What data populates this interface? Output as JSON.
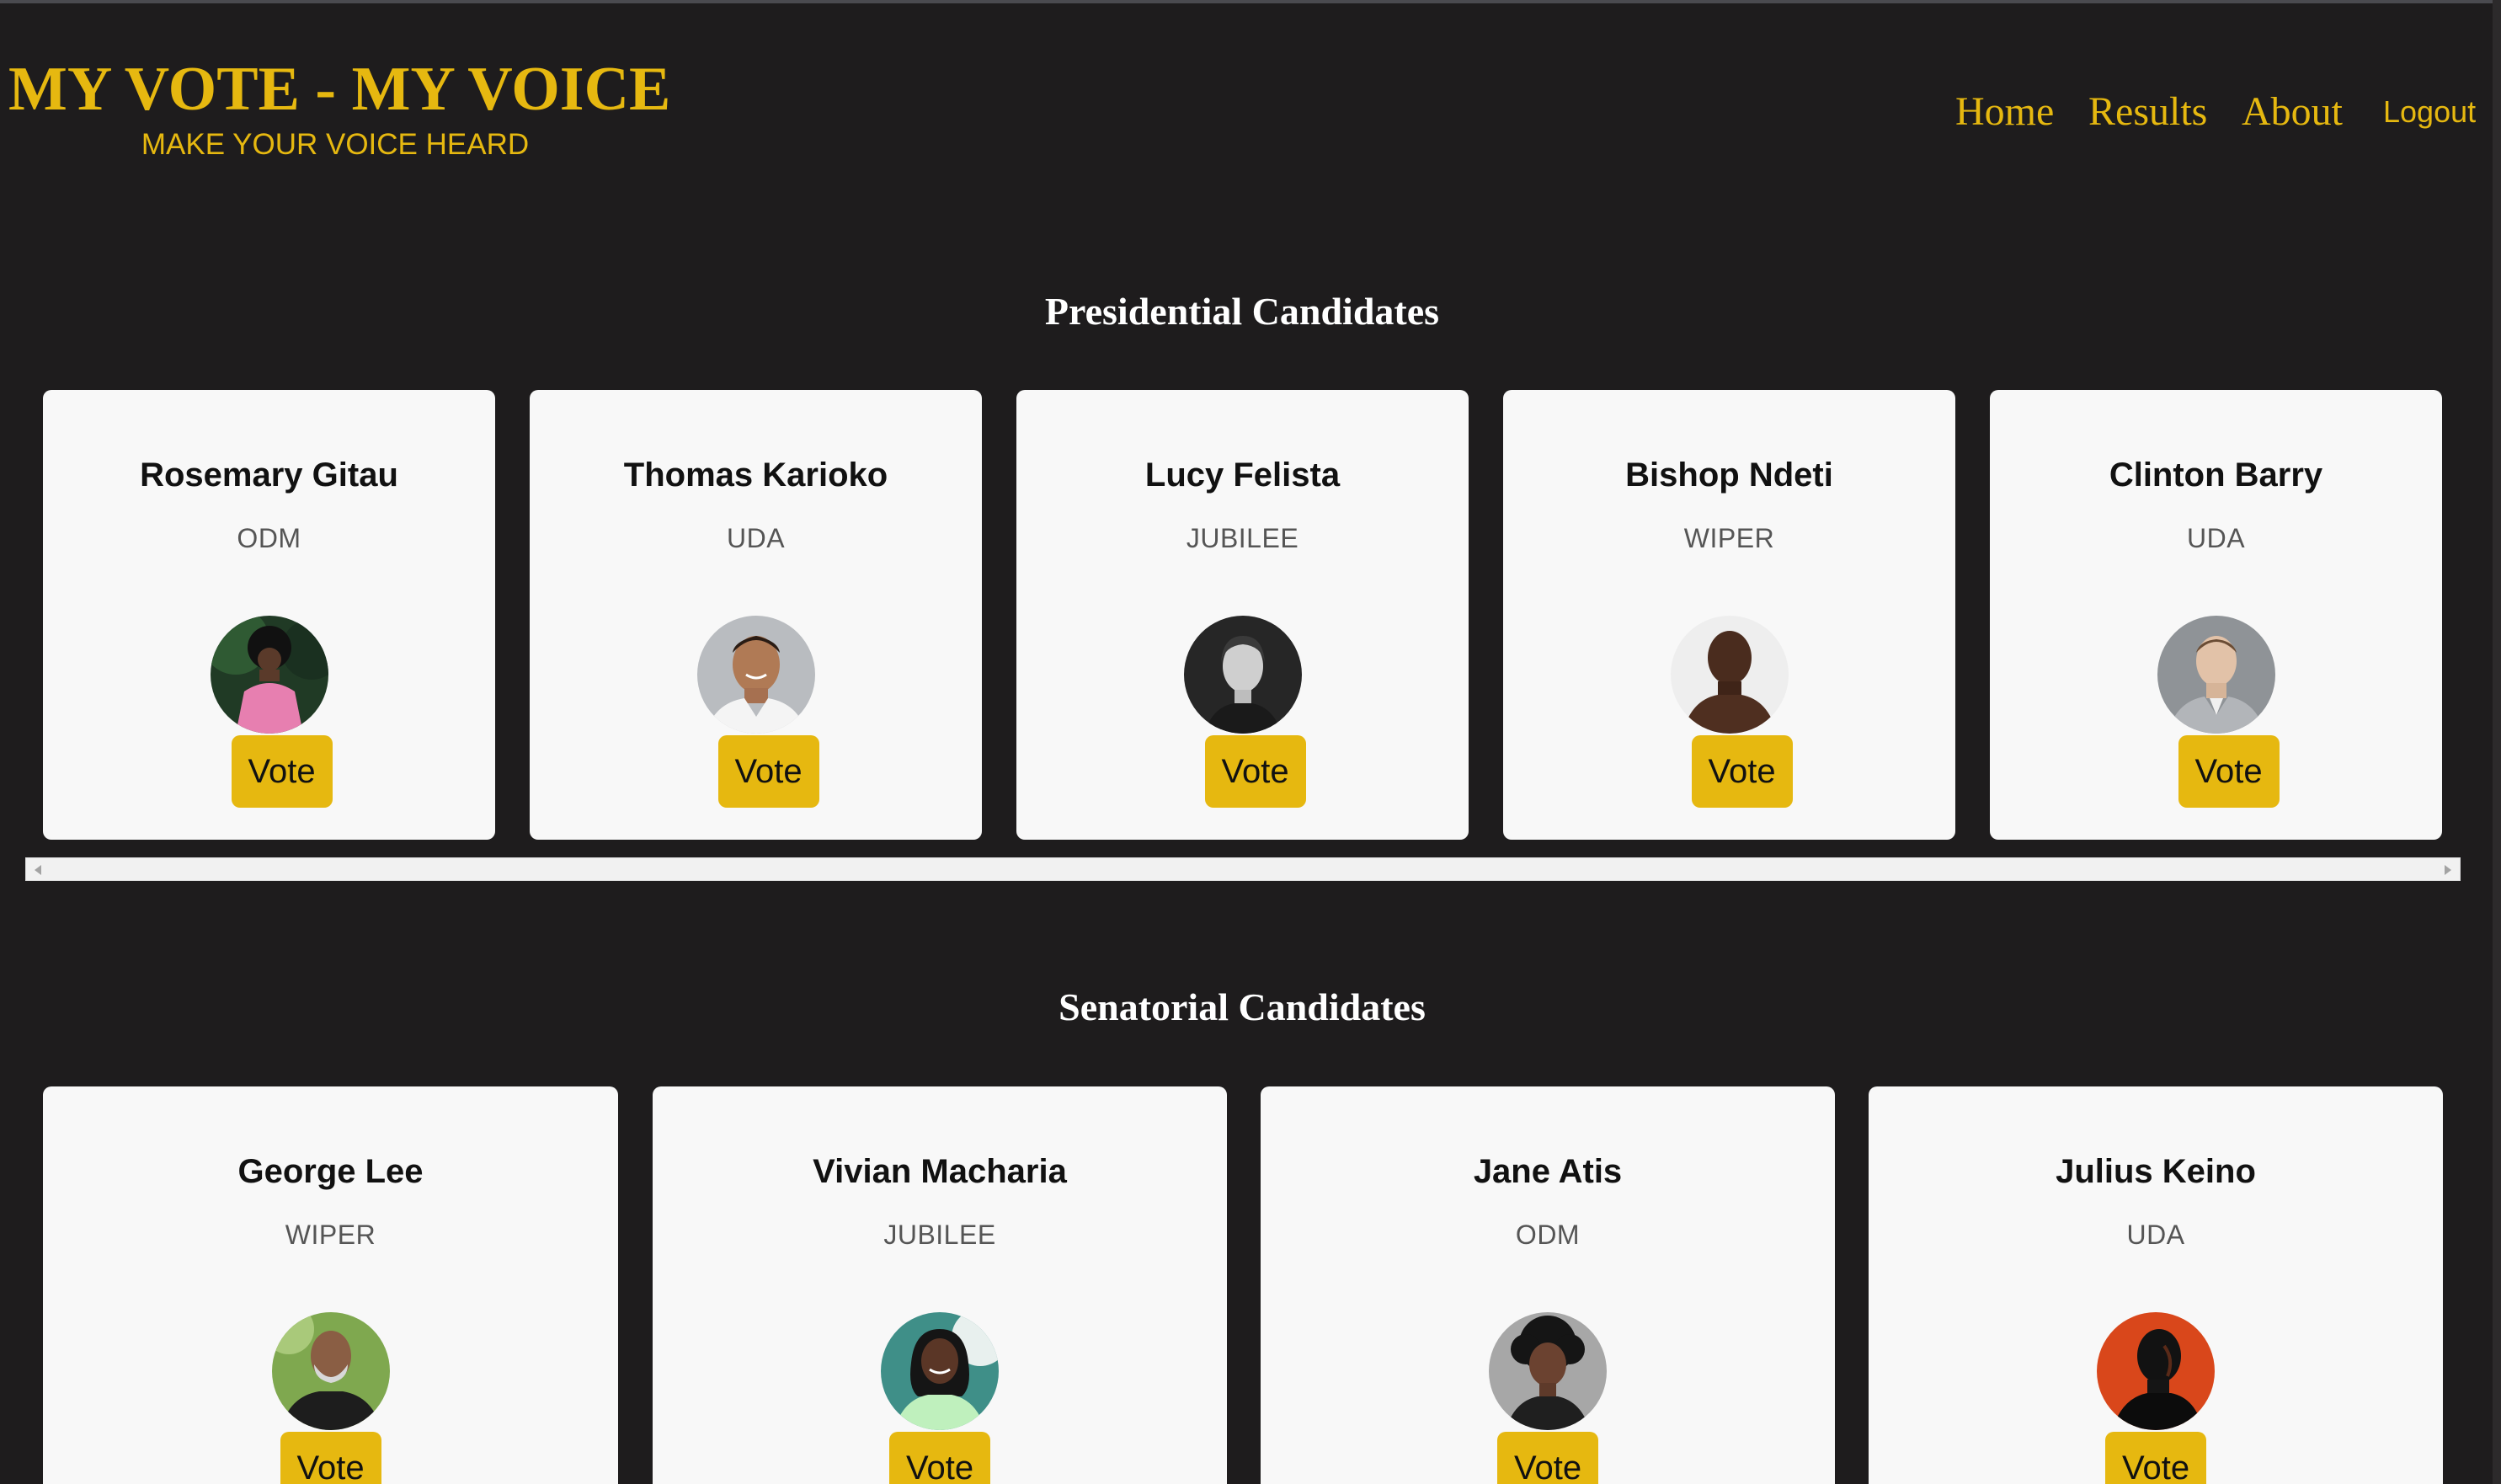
{
  "header": {
    "title": "MY VOTE - MY VOICE",
    "subtitle": "MAKE YOUR VOICE HEARD"
  },
  "nav": {
    "home": "Home",
    "results": "Results",
    "about": "About",
    "logout": "Logout"
  },
  "presidential": {
    "title": "Presidential Candidates",
    "candidates": [
      {
        "name": "Rosemary Gitau",
        "party": "ODM",
        "vote_label": "Vote"
      },
      {
        "name": "Thomas Karioko",
        "party": "UDA",
        "vote_label": "Vote"
      },
      {
        "name": "Lucy Felista",
        "party": "JUBILEE",
        "vote_label": "Vote"
      },
      {
        "name": "Bishop Ndeti",
        "party": "WIPER",
        "vote_label": "Vote"
      },
      {
        "name": "Clinton Barry",
        "party": "UDA",
        "vote_label": "Vote"
      }
    ]
  },
  "senatorial": {
    "title": "Senatorial Candidates",
    "candidates": [
      {
        "name": "George Lee",
        "party": "WIPER",
        "vote_label": "Vote"
      },
      {
        "name": "Vivian Macharia",
        "party": "JUBILEE",
        "vote_label": "Vote"
      },
      {
        "name": "Jane Atis",
        "party": "ODM",
        "vote_label": "Vote"
      },
      {
        "name": "Julius Keino",
        "party": "UDA",
        "vote_label": "Vote"
      }
    ]
  },
  "colors": {
    "background": "#1e1c1d",
    "accent": "#e6b810",
    "card": "#f8f8f8"
  }
}
